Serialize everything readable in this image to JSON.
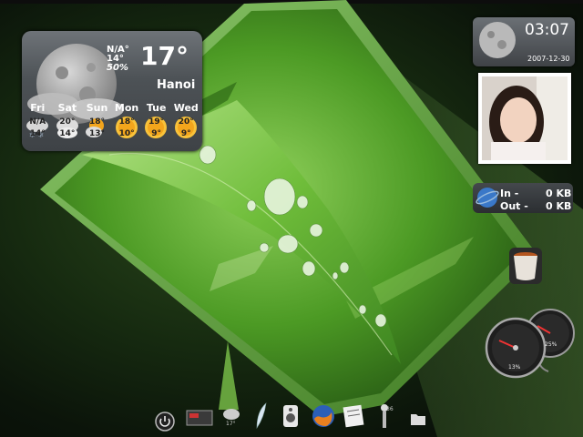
{
  "weather": {
    "current_condition": "N/A°",
    "low": "14°",
    "humidity": "50%",
    "temperature": "17°",
    "city": "Hanoi",
    "forecast": [
      {
        "day": "Fri",
        "hi": "N/A",
        "lo": "14°",
        "icon": "snow-cloud-icon"
      },
      {
        "day": "Sat",
        "hi": "20°",
        "lo": "14°",
        "icon": "cloud-icon"
      },
      {
        "day": "Sun",
        "hi": "18°",
        "lo": "13°",
        "icon": "storm-cloud-icon"
      },
      {
        "day": "Mon",
        "hi": "18°",
        "lo": "10°",
        "icon": "sun-icon"
      },
      {
        "day": "Tue",
        "hi": "19°",
        "lo": "9°",
        "icon": "sun-icon"
      },
      {
        "day": "Wed",
        "hi": "20°",
        "lo": "9°",
        "icon": "sun-icon"
      }
    ]
  },
  "clock": {
    "time": "03:07",
    "date": "2007-12-30",
    "icon": "moon-icon"
  },
  "network": {
    "in_label": "In -",
    "in_value": "0 KB",
    "out_label": "Out -",
    "out_value": "0 KB",
    "icon": "globe-icon"
  },
  "photo": {
    "icon": "portrait-photo"
  },
  "trash": {
    "icon": "trash-icon"
  },
  "gauges": {
    "cpu_label": "13%",
    "mem_label": "25%"
  },
  "dock": {
    "items": [
      {
        "name": "power",
        "icon": "power-icon"
      },
      {
        "name": "monitor",
        "icon": "monitor-icon"
      },
      {
        "name": "weather",
        "icon": "weather-icon",
        "label": "17°"
      },
      {
        "name": "quill",
        "icon": "quill-icon"
      },
      {
        "name": "speaker",
        "icon": "speaker-icon"
      },
      {
        "name": "globe",
        "icon": "firefox-icon"
      },
      {
        "name": "notes",
        "icon": "notes-icon"
      },
      {
        "name": "tools",
        "icon": "tools-icon",
        "label": "36"
      },
      {
        "name": "folder",
        "icon": "folder-icon"
      }
    ]
  },
  "colors": {
    "accent": "#5fa82f",
    "panel": "#4d5256",
    "sun": "#f3a51c"
  }
}
